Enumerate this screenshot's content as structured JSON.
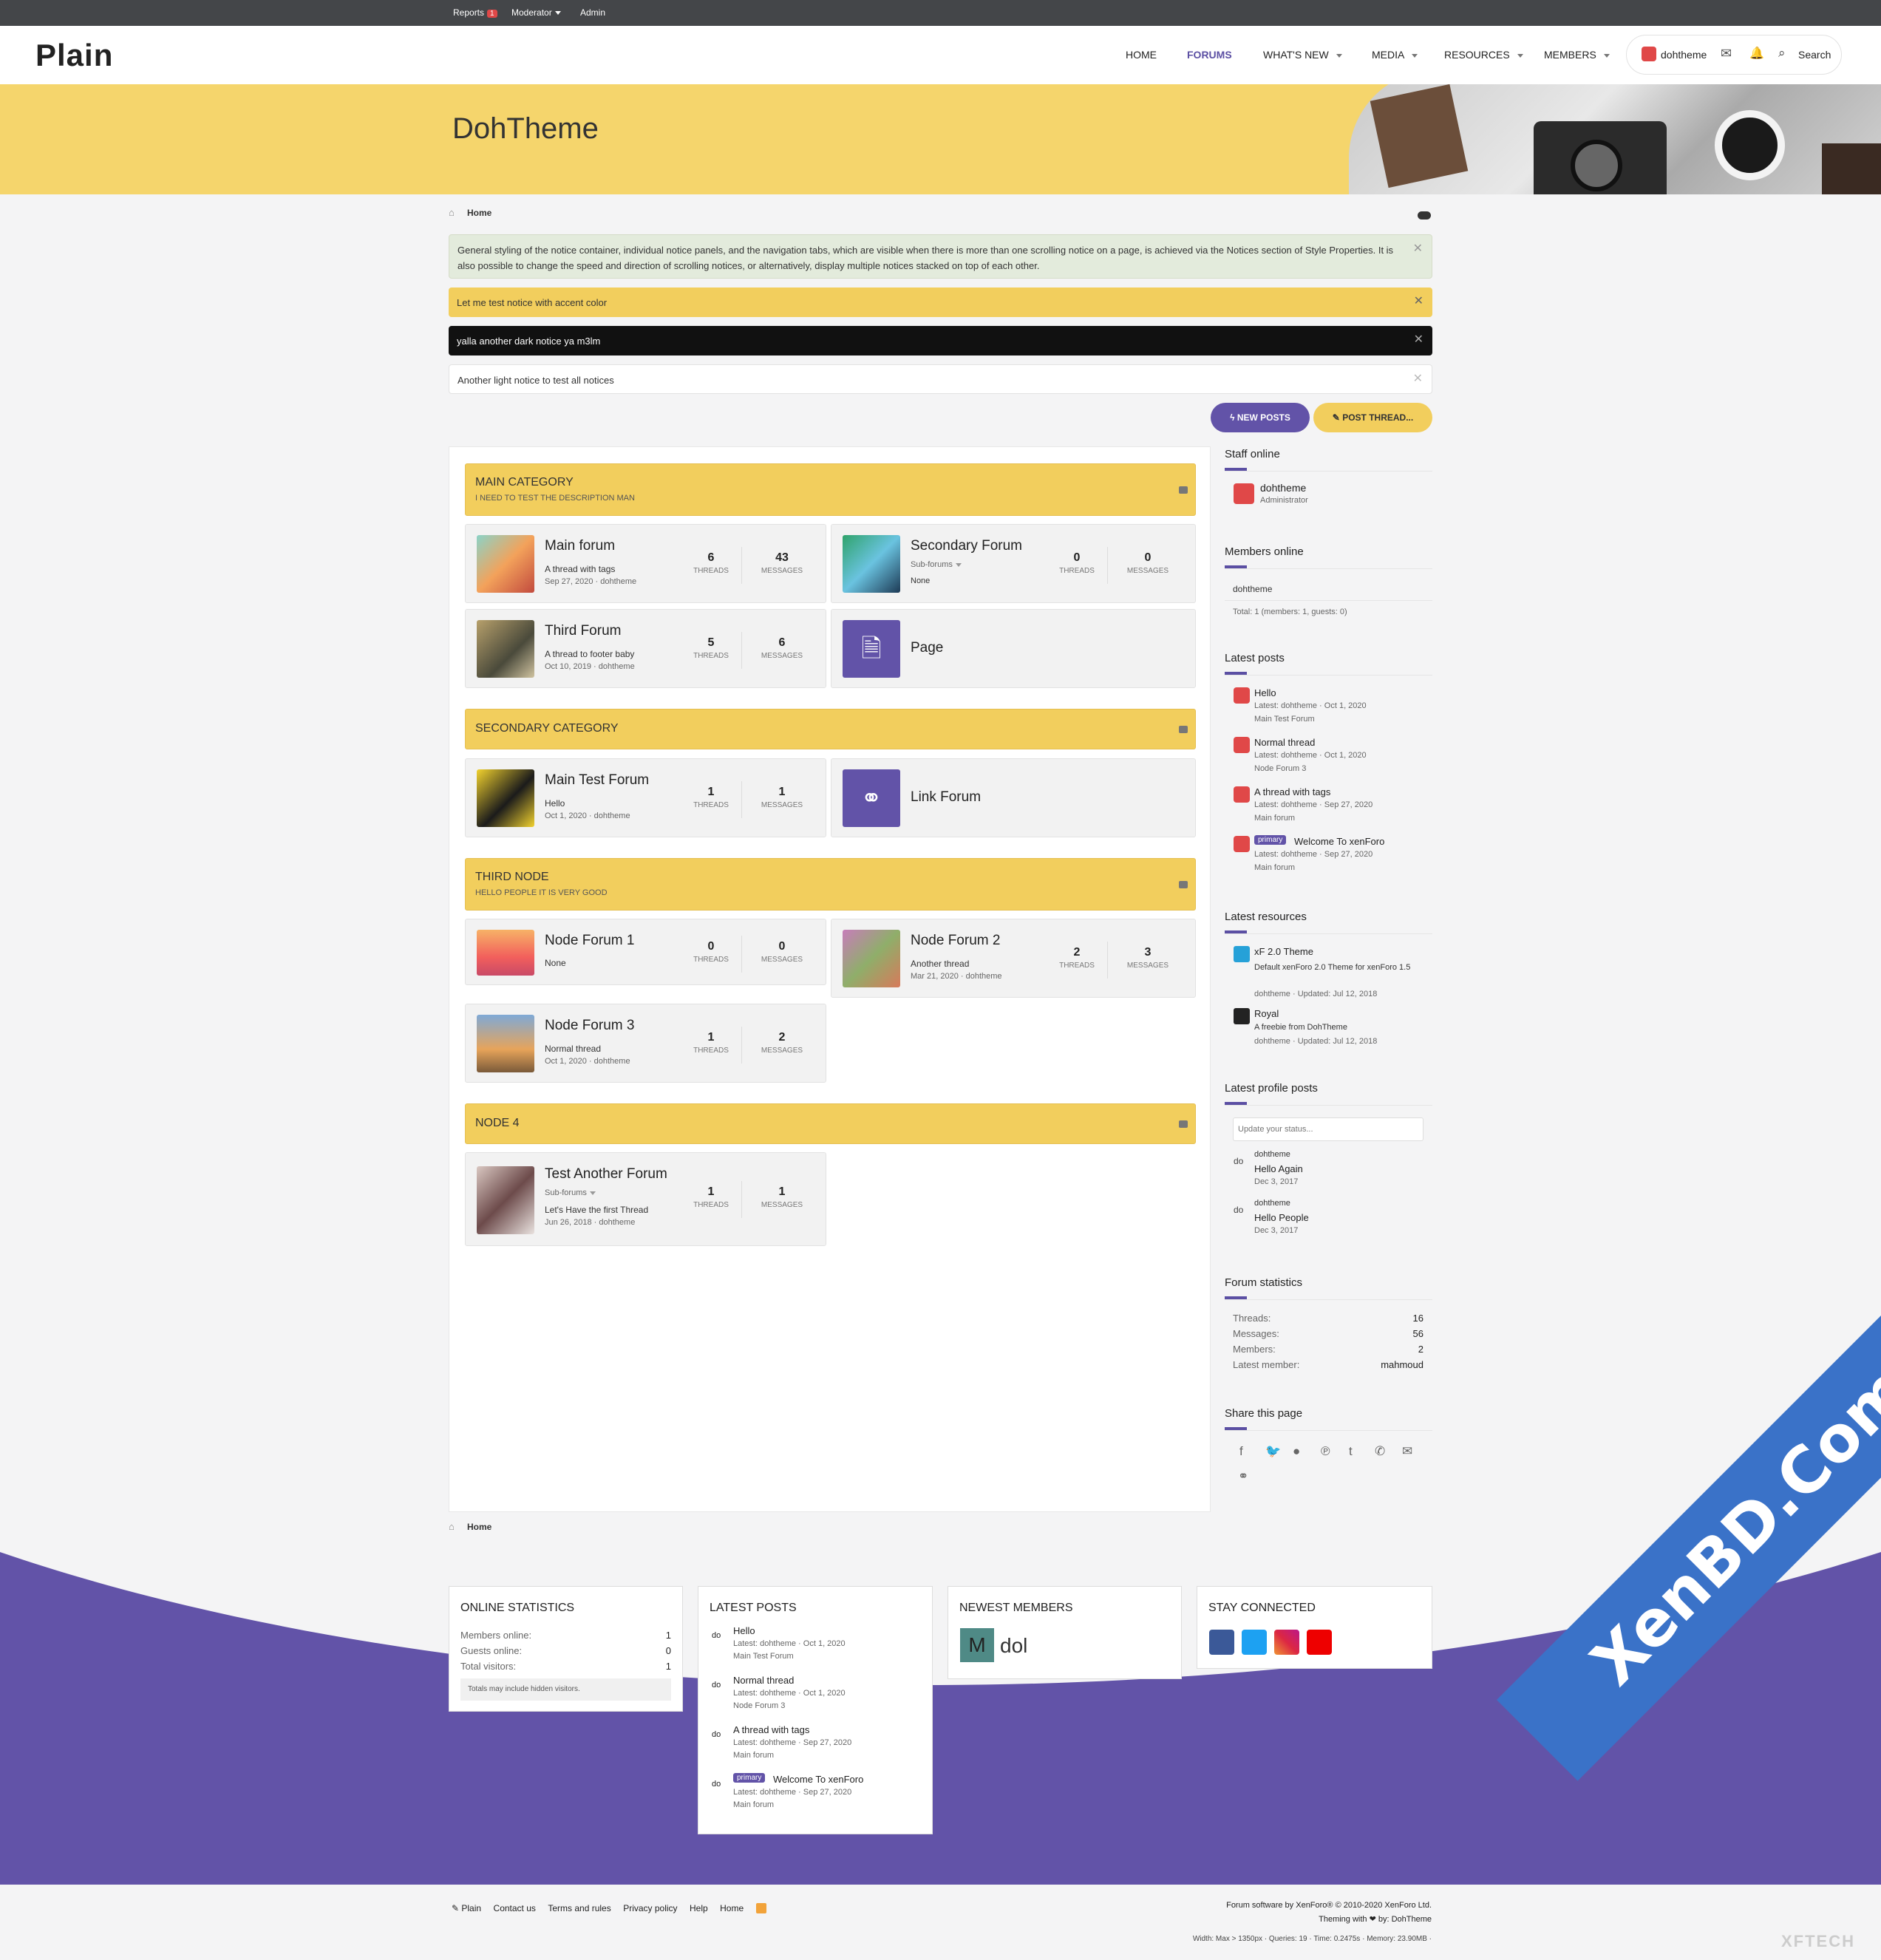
{
  "topbar": {
    "reports": "Reports",
    "reports_count": "1",
    "moderator": "Moderator",
    "admin": "Admin"
  },
  "header": {
    "logo": "Plain",
    "nav": [
      "HOME",
      "FORUMS",
      "WHAT'S NEW",
      "MEDIA",
      "RESOURCES",
      "MEMBERS"
    ],
    "user": "dohtheme",
    "search": "Search"
  },
  "banner": {
    "title": "DohTheme"
  },
  "breadcrumb": "Home",
  "notices": [
    "General styling of the notice container, individual notice panels, and the navigation tabs, which are visible when there is more than one scrolling notice on a page, is achieved via the Notices section of Style Properties. It is also possible to change the speed and direction of scrolling notices, or alternatively, display multiple notices stacked on top of each other.",
    "Let me test notice with accent color",
    "yalla another dark notice ya m3lm",
    "Another light notice to test all notices"
  ],
  "buttons": {
    "new_posts": "NEW POSTS",
    "post_thread": "POST THREAD..."
  },
  "labels": {
    "threads": "THREADS",
    "messages": "MESSAGES"
  },
  "categories": [
    {
      "title": "MAIN CATEGORY",
      "desc": "I NEED TO TEST THE DESCRIPTION MAN"
    },
    {
      "title": "SECONDARY CATEGORY",
      "desc": ""
    },
    {
      "title": "THIRD NODE",
      "desc": "HELLO PEOPLE IT IS VERY GOOD"
    },
    {
      "title": "NODE 4",
      "desc": ""
    }
  ],
  "nodes": [
    {
      "name": "Main forum",
      "line1": "A thread with tags",
      "line2": "Sep 27, 2020 · dohtheme",
      "threads": "6",
      "messages": "43"
    },
    {
      "name": "Secondary Forum",
      "line1": "Sub-forums",
      "line2": "None",
      "threads": "0",
      "messages": "0"
    },
    {
      "name": "Third Forum",
      "line1": "A thread to footer baby",
      "line2": "Oct 10, 2019 · dohtheme",
      "threads": "5",
      "messages": "6"
    },
    {
      "name": "Page"
    },
    {
      "name": "Main Test Forum",
      "line1": "Hello",
      "line2": "Oct 1, 2020 · dohtheme",
      "threads": "1",
      "messages": "1"
    },
    {
      "name": "Link Forum"
    },
    {
      "name": "Node Forum 1",
      "line1": "None",
      "line2": "",
      "threads": "0",
      "messages": "0"
    },
    {
      "name": "Node Forum 2",
      "line1": "Another thread",
      "line2": "Mar 21, 2020 · dohtheme",
      "threads": "2",
      "messages": "3"
    },
    {
      "name": "Node Forum 3",
      "line1": "Normal thread",
      "line2": "Oct 1, 2020 · dohtheme",
      "threads": "1",
      "messages": "2"
    },
    {
      "name": "Test Another Forum",
      "line0": "Sub-forums",
      "line1": "Let's Have the first Thread",
      "line2": "Jun 26, 2018 · dohtheme",
      "threads": "1",
      "messages": "1"
    }
  ],
  "sidebar": {
    "staff_title": "Staff online",
    "staff_name": "dohtheme",
    "staff_role": "Administrator",
    "members_title": "Members online",
    "members_name": "dohtheme",
    "members_total": "Total: 1 (members: 1, guests: 0)",
    "posts_title": "Latest posts",
    "posts": [
      {
        "title": "Hello",
        "meta": "Latest: dohtheme · Oct 1, 2020",
        "forum": "Main Test Forum"
      },
      {
        "title": "Normal thread",
        "meta": "Latest: dohtheme · Oct 1, 2020",
        "forum": "Node Forum 3"
      },
      {
        "title": "A thread with tags",
        "meta": "Latest: dohtheme · Sep 27, 2020",
        "forum": "Main forum"
      },
      {
        "title": "Welcome To xenForo",
        "prefix": "primary",
        "meta": "Latest: dohtheme · Sep 27, 2020",
        "forum": "Main forum"
      }
    ],
    "resources_title": "Latest resources",
    "resources": [
      {
        "title": "xF 2.0 Theme",
        "desc": "Default xenForo 2.0 Theme for xenForo 1.5",
        "meta": "dohtheme · Updated: Jul 12, 2018"
      },
      {
        "title": "Royal",
        "desc": "A freebie from DohTheme",
        "meta": "dohtheme · Updated: Jul 12, 2018"
      }
    ],
    "profile_title": "Latest profile posts",
    "status_placeholder": "Update your status...",
    "profile_posts": [
      {
        "user": "dohtheme",
        "text": "Hello Again",
        "date": "Dec 3, 2017",
        "av": "do"
      },
      {
        "user": "dohtheme",
        "text": "Hello People",
        "date": "Dec 3, 2017",
        "av": "do"
      }
    ],
    "stats_title": "Forum statistics",
    "stats": [
      [
        "Threads:",
        "16"
      ],
      [
        "Messages:",
        "56"
      ],
      [
        "Members:",
        "2"
      ],
      [
        "Latest member:",
        "mahmoud"
      ]
    ],
    "share_title": "Share this page"
  },
  "footer": {
    "online_title": "ONLINE STATISTICS",
    "online": [
      [
        "Members online:",
        "1"
      ],
      [
        "Guests online:",
        "0"
      ],
      [
        "Total visitors:",
        "1"
      ]
    ],
    "online_note": "Totals may include hidden visitors.",
    "latest_title": "LATEST POSTS",
    "newest_title": "NEWEST MEMBERS",
    "newest_letter": "M",
    "newest_name": "dol",
    "stay_title": "STAY CONNECTED",
    "links": [
      "Plain",
      "Contact us",
      "Terms and rules",
      "Privacy policy",
      "Help",
      "Home"
    ],
    "copyright": "Forum software by XenForo® © 2010-2020 XenForo Ltd.",
    "theming": "Theming with ❤ by: DohTheme",
    "debug": "Width: Max > 1350px · Queries: 19 · Time: 0.2475s · Memory: 23.90MB ·"
  },
  "watermark": "XenBD.Com",
  "watermark2": "XFTECH",
  "colors": {
    "accent": "#5b4fa3",
    "yellow": "#f2ce5d",
    "banner": "#f5d56c"
  }
}
